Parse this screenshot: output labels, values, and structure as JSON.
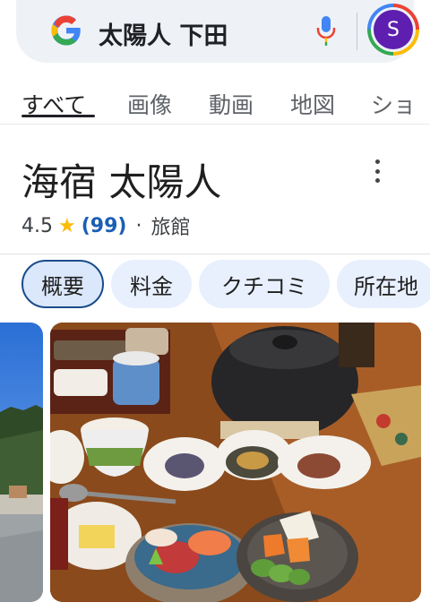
{
  "search": {
    "query": "太陽人 下田",
    "avatar_letter": "S"
  },
  "tabs": [
    {
      "label": "すべて",
      "active": true
    },
    {
      "label": "画像",
      "active": false
    },
    {
      "label": "動画",
      "active": false
    },
    {
      "label": "地図",
      "active": false
    },
    {
      "label": "ショ",
      "active": false
    }
  ],
  "place": {
    "name": "海宿 太陽人",
    "rating": "4.5",
    "review_count": "(99)",
    "separator": "·",
    "category": "旅館"
  },
  "chips": [
    {
      "label": "概要",
      "active": true
    },
    {
      "label": "料金",
      "active": false
    },
    {
      "label": "クチコミ",
      "active": false
    },
    {
      "label": "所在地",
      "active": false
    }
  ],
  "colors": {
    "search_bg": "#eef2f7",
    "avatar": "#5e1fb0",
    "link_blue": "#1a5fb4",
    "star": "#fbbc04",
    "chip_bg": "#e8f0fe"
  }
}
